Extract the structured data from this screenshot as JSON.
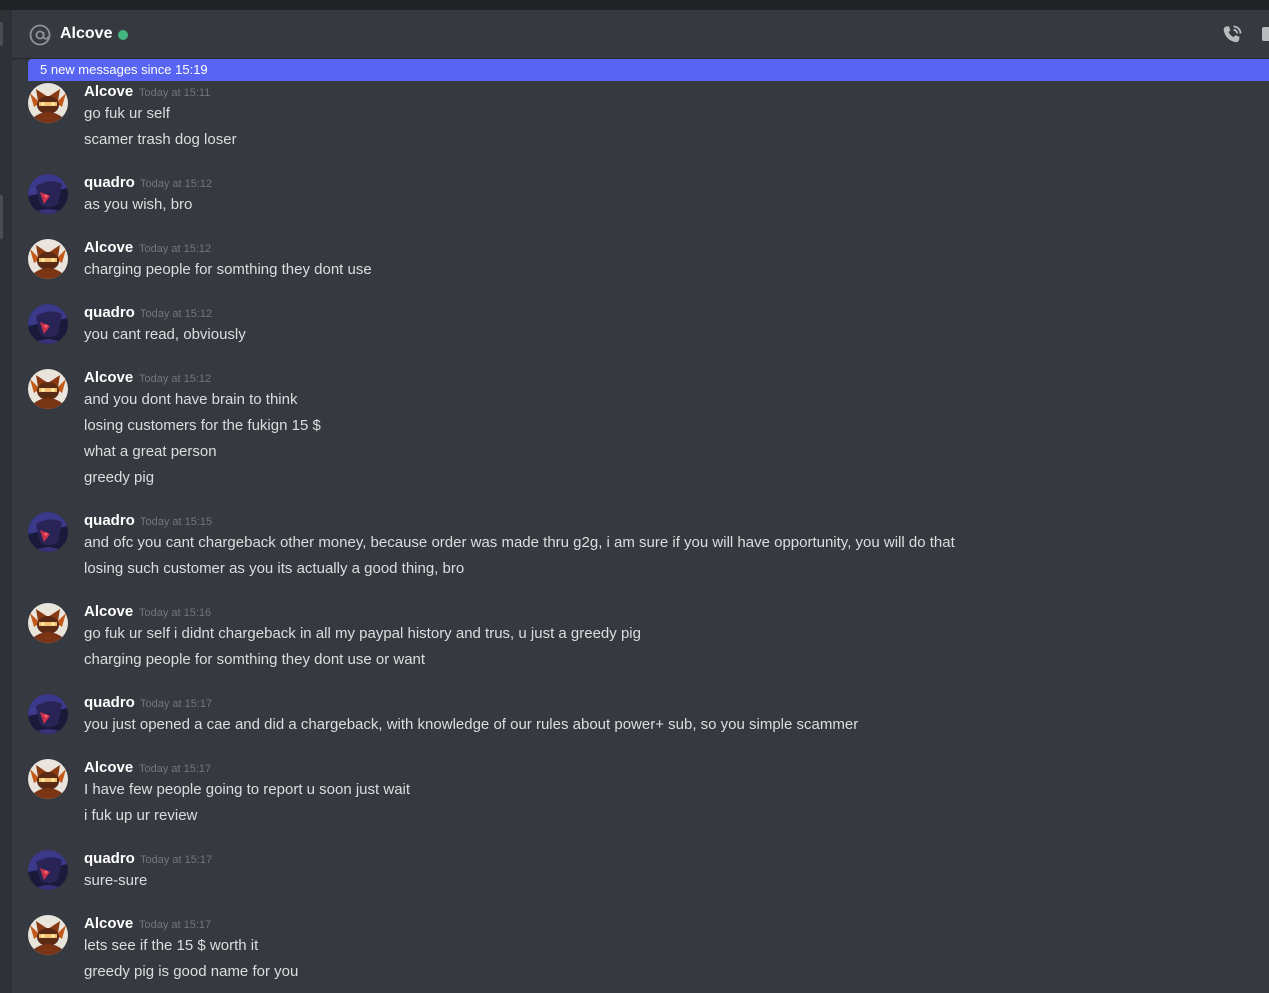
{
  "header": {
    "title": "Alcove",
    "at_icon": "at-icon",
    "status": "online",
    "status_color": "#43b581",
    "call_icon": "phone-call-icon"
  },
  "new_messages_bar": {
    "text": "5 new messages since 15:19",
    "color": "#5865f2"
  },
  "messages": [
    {
      "author": "Alcove",
      "avatar": "alcove-avatar",
      "timestamp": "Today at 15:11",
      "lines": [
        "go fuk ur self",
        "scamer trash dog loser"
      ]
    },
    {
      "author": "quadro",
      "avatar": "quadro-avatar",
      "timestamp": "Today at 15:12",
      "lines": [
        "as you wish, bro"
      ]
    },
    {
      "author": "Alcove",
      "avatar": "alcove-avatar",
      "timestamp": "Today at 15:12",
      "lines": [
        "charging people for somthing they dont use"
      ]
    },
    {
      "author": "quadro",
      "avatar": "quadro-avatar",
      "timestamp": "Today at 15:12",
      "lines": [
        "you cant read, obviously"
      ]
    },
    {
      "author": "Alcove",
      "avatar": "alcove-avatar",
      "timestamp": "Today at 15:12",
      "lines": [
        "and you dont have brain to think",
        "losing customers for the fukign 15 $",
        "what a great person",
        "greedy pig"
      ]
    },
    {
      "author": "quadro",
      "avatar": "quadro-avatar",
      "timestamp": "Today at 15:15",
      "lines": [
        "and ofc you cant chargeback other money, because order was made thru g2g, i am sure if you will have opportunity, you will do that",
        "losing such customer as you its actually a good thing, bro"
      ]
    },
    {
      "author": "Alcove",
      "avatar": "alcove-avatar",
      "timestamp": "Today at 15:16",
      "lines": [
        "go fuk ur self i didnt chargeback in all my paypal history and trus, u just a greedy pig",
        "charging people for somthing they dont use or want"
      ]
    },
    {
      "author": "quadro",
      "avatar": "quadro-avatar",
      "timestamp": "Today at 15:17",
      "lines": [
        "you just opened a cae and did a chargeback, with knowledge of our rules about power+ sub, so you simple scammer"
      ]
    },
    {
      "author": "Alcove",
      "avatar": "alcove-avatar",
      "timestamp": "Today at 15:17",
      "lines": [
        "I have few people going to report u soon just wait",
        "i fuk up ur review"
      ]
    },
    {
      "author": "quadro",
      "avatar": "quadro-avatar",
      "timestamp": "Today at 15:17",
      "lines": [
        "sure-sure"
      ]
    },
    {
      "author": "Alcove",
      "avatar": "alcove-avatar",
      "timestamp": "Today at 15:17",
      "lines": [
        "lets see if the 15 $ worth it",
        "greedy pig is good name for you"
      ]
    }
  ]
}
